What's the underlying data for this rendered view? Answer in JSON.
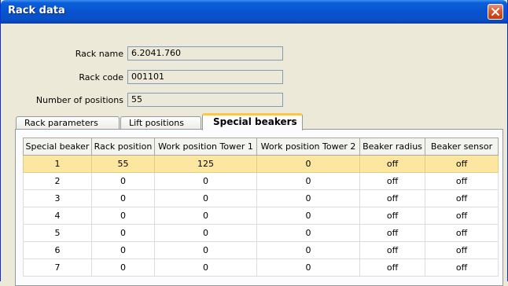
{
  "window": {
    "title": "Rack data"
  },
  "form": {
    "rack_name_label": "Rack name",
    "rack_name_value": "6.2041.760",
    "rack_code_label": "Rack code",
    "rack_code_value": "001101",
    "positions_label": "Number of positions",
    "positions_value": "55"
  },
  "tabs": [
    {
      "label": "Rack parameters"
    },
    {
      "label": "Lift positions"
    },
    {
      "label": "Special beakers",
      "active": true
    }
  ],
  "table": {
    "columns": [
      "Special beaker",
      "Rack position",
      "Work position Tower 1",
      "Work position Tower 2",
      "Beaker radius",
      "Beaker sensor"
    ],
    "rows": [
      [
        "1",
        "55",
        "125",
        "0",
        "off",
        "off"
      ],
      [
        "2",
        "0",
        "0",
        "0",
        "off",
        "off"
      ],
      [
        "3",
        "0",
        "0",
        "0",
        "off",
        "off"
      ],
      [
        "4",
        "0",
        "0",
        "0",
        "off",
        "off"
      ],
      [
        "5",
        "0",
        "0",
        "0",
        "off",
        "off"
      ],
      [
        "6",
        "0",
        "0",
        "0",
        "off",
        "off"
      ],
      [
        "7",
        "0",
        "0",
        "0",
        "off",
        "off"
      ]
    ],
    "selected_row": 0
  },
  "colors": {
    "titlebar": "#0853cf",
    "selected_row": "#fde6a0",
    "active_tab_accent": "#ffc83c"
  }
}
